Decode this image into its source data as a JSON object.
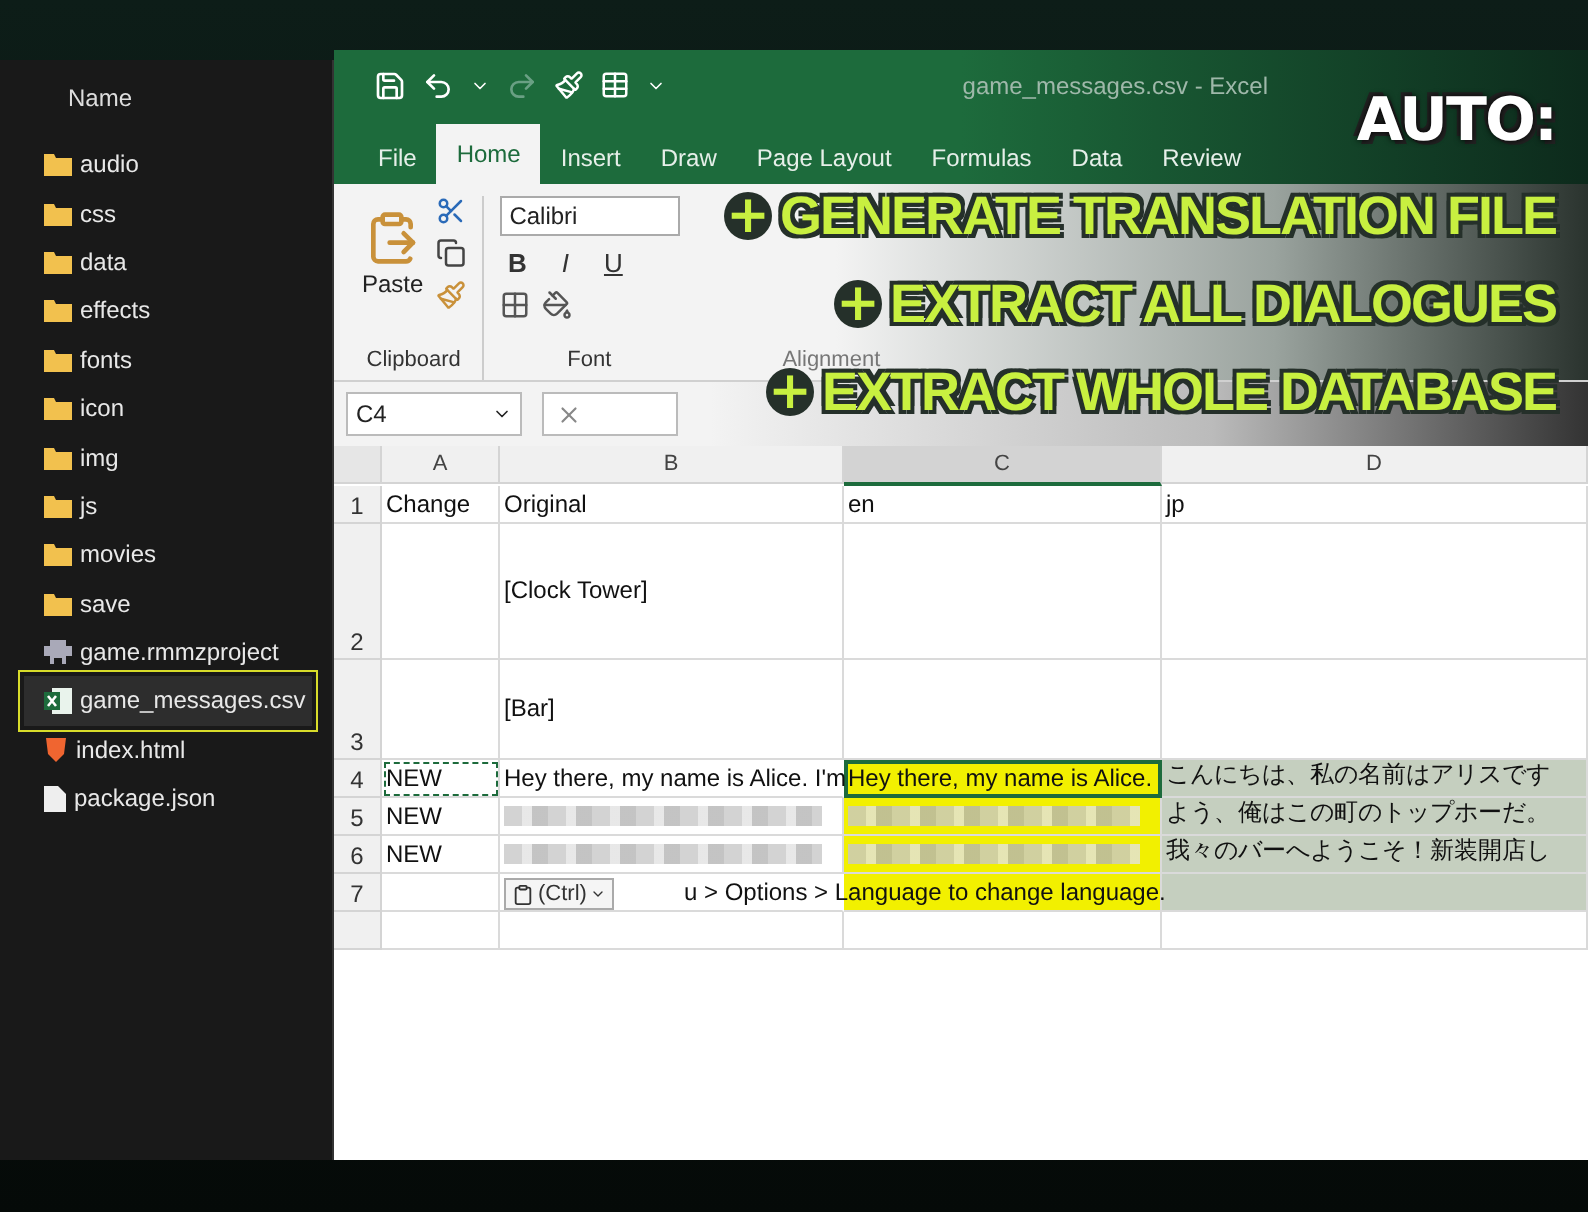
{
  "explorer": {
    "header": "Name",
    "items": [
      {
        "name": "audio",
        "kind": "folder",
        "selected": false
      },
      {
        "name": "css",
        "kind": "folder",
        "selected": false
      },
      {
        "name": "data",
        "kind": "folder",
        "selected": false
      },
      {
        "name": "effects",
        "kind": "folder",
        "selected": false
      },
      {
        "name": "fonts",
        "kind": "folder",
        "selected": false
      },
      {
        "name": "icon",
        "kind": "folder",
        "selected": false
      },
      {
        "name": "img",
        "kind": "folder",
        "selected": false
      },
      {
        "name": "js",
        "kind": "folder",
        "selected": false
      },
      {
        "name": "movies",
        "kind": "folder",
        "selected": false
      },
      {
        "name": "save",
        "kind": "folder",
        "selected": false
      },
      {
        "name": "game.rmmzproject",
        "kind": "project",
        "selected": false
      },
      {
        "name": "game_messages.csv",
        "kind": "excel",
        "selected": true
      },
      {
        "name": "index.html",
        "kind": "html",
        "selected": false
      },
      {
        "name": "package.json",
        "kind": "json",
        "selected": false
      }
    ]
  },
  "excel": {
    "title": "game_messages.csv - Excel",
    "tabs": [
      {
        "label": "File",
        "selected": false
      },
      {
        "label": "Home",
        "selected": true
      },
      {
        "label": "Insert",
        "selected": false
      },
      {
        "label": "Draw",
        "selected": false
      },
      {
        "label": "Page Layout",
        "selected": false
      },
      {
        "label": "Formulas",
        "selected": false
      },
      {
        "label": "Data",
        "selected": false
      },
      {
        "label": "Review",
        "selected": false
      }
    ],
    "clipboard": {
      "paste": "Paste",
      "label": "Clipboard"
    },
    "font": {
      "name": "Calibri",
      "styles": [
        "B",
        "I",
        "U"
      ],
      "label": "Font"
    },
    "alignment": {
      "label": "Alignment"
    },
    "name_box": "C4",
    "columns": [
      {
        "label": "A",
        "selected": false
      },
      {
        "label": "B",
        "selected": false
      },
      {
        "label": "C",
        "selected": true
      },
      {
        "label": "D",
        "selected": false
      }
    ],
    "rows": [
      {
        "number": "1",
        "cells": [
          {
            "kind": "text",
            "text": "Change"
          },
          {
            "kind": "text",
            "text": "Original"
          },
          {
            "kind": "text",
            "text": "en"
          },
          {
            "kind": "text",
            "text": "jp"
          }
        ]
      },
      {
        "number": "2",
        "cells": [
          {
            "kind": "empty"
          },
          {
            "kind": "text",
            "text": "[Clock Tower]"
          },
          {
            "kind": "empty"
          },
          {
            "kind": "empty"
          }
        ]
      },
      {
        "number": "3",
        "cells": [
          {
            "kind": "empty"
          },
          {
            "kind": "text",
            "text": "[Bar]"
          },
          {
            "kind": "empty"
          },
          {
            "kind": "empty"
          }
        ]
      },
      {
        "number": "4",
        "cells": [
          {
            "kind": "text",
            "text": "NEW",
            "copied": true
          },
          {
            "kind": "text",
            "text": "Hey there, my name is Alice. I'm"
          },
          {
            "kind": "text",
            "text": "Hey there, my name is Alice.",
            "color": "#f2f000",
            "active": true
          },
          {
            "kind": "text",
            "text": "こんにちは、私の名前はアリスです",
            "color": "#c5cfbf"
          }
        ]
      },
      {
        "number": "5",
        "cells": [
          {
            "kind": "text",
            "text": "NEW"
          },
          {
            "kind": "blurred"
          },
          {
            "kind": "blurred",
            "color": "#f2f000"
          },
          {
            "kind": "text",
            "text": "よう、俺はこの町のトップホーだ。",
            "color": "#c5cfbf"
          }
        ]
      },
      {
        "number": "6",
        "cells": [
          {
            "kind": "text",
            "text": "NEW"
          },
          {
            "kind": "blurred"
          },
          {
            "kind": "blurred",
            "color": "#f2f000"
          },
          {
            "kind": "text",
            "text": "我々のバーへようこそ！新装開店し",
            "color": "#c5cfbf"
          }
        ]
      },
      {
        "number": "7",
        "cells": [
          {
            "kind": "empty"
          },
          {
            "kind": "text",
            "text": "u > Options > Language to change language.",
            "paste_tag": "(Ctrl)"
          },
          {
            "kind": "empty",
            "color": "#f2f000"
          },
          {
            "kind": "empty",
            "color": "#c5cfbf"
          }
        ]
      },
      {
        "number": "",
        "cells": [
          {
            "kind": "empty"
          },
          {
            "kind": "empty"
          },
          {
            "kind": "empty"
          },
          {
            "kind": "empty"
          }
        ]
      }
    ]
  },
  "overlay": {
    "heading": "AUTO:",
    "features": [
      "GENERATE TRANSLATION FILE",
      "EXTRACT ALL DIALOGUES",
      "EXTRACT WHOLE DATABASE"
    ],
    "bullet": "+"
  }
}
